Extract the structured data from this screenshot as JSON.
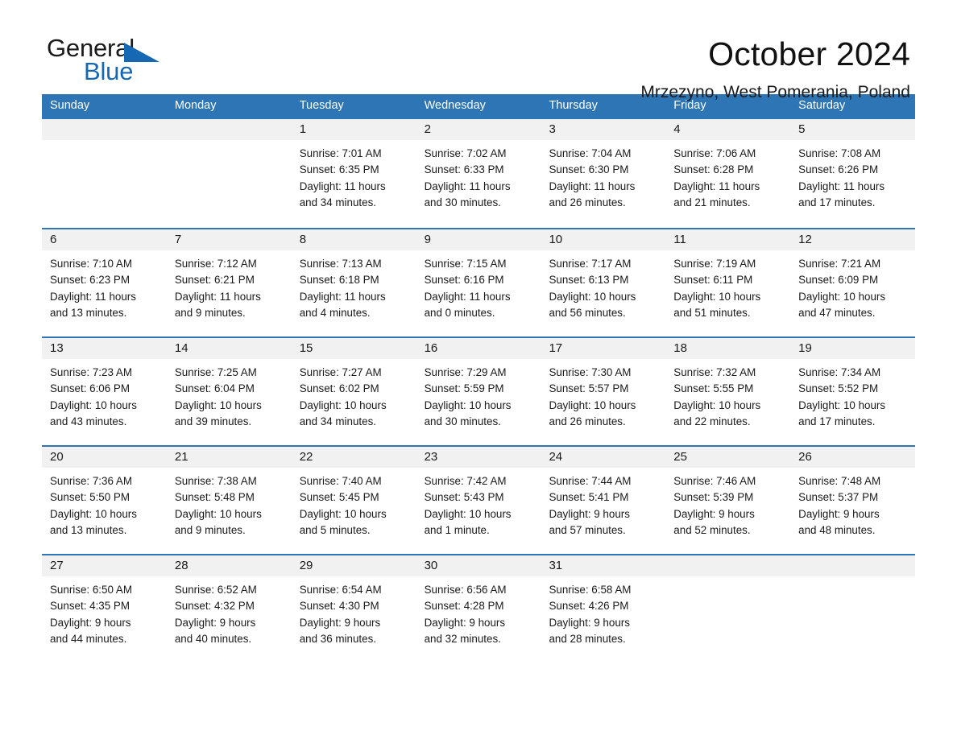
{
  "logo": {
    "word1": "General",
    "word2": "Blue",
    "triangle": "triangle-mark",
    "blue": "#1668b3"
  },
  "header": {
    "month_title": "October 2024",
    "location": "Mrzezyno, West Pomerania, Poland"
  },
  "colors": {
    "header_blue": "#2e75b6",
    "cell_number_band": "#f1f1f1",
    "text": "#1a1a1a"
  },
  "calendar": {
    "weekday_headers": [
      "Sunday",
      "Monday",
      "Tuesday",
      "Wednesday",
      "Thursday",
      "Friday",
      "Saturday"
    ],
    "weeks": [
      [
        {
          "day": "",
          "sunrise": "",
          "sunset": "",
          "daylight_line1": "",
          "daylight_line2": ""
        },
        {
          "day": "",
          "sunrise": "",
          "sunset": "",
          "daylight_line1": "",
          "daylight_line2": ""
        },
        {
          "day": "1",
          "sunrise": "Sunrise: 7:01 AM",
          "sunset": "Sunset: 6:35 PM",
          "daylight_line1": "Daylight: 11 hours",
          "daylight_line2": "and 34 minutes."
        },
        {
          "day": "2",
          "sunrise": "Sunrise: 7:02 AM",
          "sunset": "Sunset: 6:33 PM",
          "daylight_line1": "Daylight: 11 hours",
          "daylight_line2": "and 30 minutes."
        },
        {
          "day": "3",
          "sunrise": "Sunrise: 7:04 AM",
          "sunset": "Sunset: 6:30 PM",
          "daylight_line1": "Daylight: 11 hours",
          "daylight_line2": "and 26 minutes."
        },
        {
          "day": "4",
          "sunrise": "Sunrise: 7:06 AM",
          "sunset": "Sunset: 6:28 PM",
          "daylight_line1": "Daylight: 11 hours",
          "daylight_line2": "and 21 minutes."
        },
        {
          "day": "5",
          "sunrise": "Sunrise: 7:08 AM",
          "sunset": "Sunset: 6:26 PM",
          "daylight_line1": "Daylight: 11 hours",
          "daylight_line2": "and 17 minutes."
        }
      ],
      [
        {
          "day": "6",
          "sunrise": "Sunrise: 7:10 AM",
          "sunset": "Sunset: 6:23 PM",
          "daylight_line1": "Daylight: 11 hours",
          "daylight_line2": "and 13 minutes."
        },
        {
          "day": "7",
          "sunrise": "Sunrise: 7:12 AM",
          "sunset": "Sunset: 6:21 PM",
          "daylight_line1": "Daylight: 11 hours",
          "daylight_line2": "and 9 minutes."
        },
        {
          "day": "8",
          "sunrise": "Sunrise: 7:13 AM",
          "sunset": "Sunset: 6:18 PM",
          "daylight_line1": "Daylight: 11 hours",
          "daylight_line2": "and 4 minutes."
        },
        {
          "day": "9",
          "sunrise": "Sunrise: 7:15 AM",
          "sunset": "Sunset: 6:16 PM",
          "daylight_line1": "Daylight: 11 hours",
          "daylight_line2": "and 0 minutes."
        },
        {
          "day": "10",
          "sunrise": "Sunrise: 7:17 AM",
          "sunset": "Sunset: 6:13 PM",
          "daylight_line1": "Daylight: 10 hours",
          "daylight_line2": "and 56 minutes."
        },
        {
          "day": "11",
          "sunrise": "Sunrise: 7:19 AM",
          "sunset": "Sunset: 6:11 PM",
          "daylight_line1": "Daylight: 10 hours",
          "daylight_line2": "and 51 minutes."
        },
        {
          "day": "12",
          "sunrise": "Sunrise: 7:21 AM",
          "sunset": "Sunset: 6:09 PM",
          "daylight_line1": "Daylight: 10 hours",
          "daylight_line2": "and 47 minutes."
        }
      ],
      [
        {
          "day": "13",
          "sunrise": "Sunrise: 7:23 AM",
          "sunset": "Sunset: 6:06 PM",
          "daylight_line1": "Daylight: 10 hours",
          "daylight_line2": "and 43 minutes."
        },
        {
          "day": "14",
          "sunrise": "Sunrise: 7:25 AM",
          "sunset": "Sunset: 6:04 PM",
          "daylight_line1": "Daylight: 10 hours",
          "daylight_line2": "and 39 minutes."
        },
        {
          "day": "15",
          "sunrise": "Sunrise: 7:27 AM",
          "sunset": "Sunset: 6:02 PM",
          "daylight_line1": "Daylight: 10 hours",
          "daylight_line2": "and 34 minutes."
        },
        {
          "day": "16",
          "sunrise": "Sunrise: 7:29 AM",
          "sunset": "Sunset: 5:59 PM",
          "daylight_line1": "Daylight: 10 hours",
          "daylight_line2": "and 30 minutes."
        },
        {
          "day": "17",
          "sunrise": "Sunrise: 7:30 AM",
          "sunset": "Sunset: 5:57 PM",
          "daylight_line1": "Daylight: 10 hours",
          "daylight_line2": "and 26 minutes."
        },
        {
          "day": "18",
          "sunrise": "Sunrise: 7:32 AM",
          "sunset": "Sunset: 5:55 PM",
          "daylight_line1": "Daylight: 10 hours",
          "daylight_line2": "and 22 minutes."
        },
        {
          "day": "19",
          "sunrise": "Sunrise: 7:34 AM",
          "sunset": "Sunset: 5:52 PM",
          "daylight_line1": "Daylight: 10 hours",
          "daylight_line2": "and 17 minutes."
        }
      ],
      [
        {
          "day": "20",
          "sunrise": "Sunrise: 7:36 AM",
          "sunset": "Sunset: 5:50 PM",
          "daylight_line1": "Daylight: 10 hours",
          "daylight_line2": "and 13 minutes."
        },
        {
          "day": "21",
          "sunrise": "Sunrise: 7:38 AM",
          "sunset": "Sunset: 5:48 PM",
          "daylight_line1": "Daylight: 10 hours",
          "daylight_line2": "and 9 minutes."
        },
        {
          "day": "22",
          "sunrise": "Sunrise: 7:40 AM",
          "sunset": "Sunset: 5:45 PM",
          "daylight_line1": "Daylight: 10 hours",
          "daylight_line2": "and 5 minutes."
        },
        {
          "day": "23",
          "sunrise": "Sunrise: 7:42 AM",
          "sunset": "Sunset: 5:43 PM",
          "daylight_line1": "Daylight: 10 hours",
          "daylight_line2": "and 1 minute."
        },
        {
          "day": "24",
          "sunrise": "Sunrise: 7:44 AM",
          "sunset": "Sunset: 5:41 PM",
          "daylight_line1": "Daylight: 9 hours",
          "daylight_line2": "and 57 minutes."
        },
        {
          "day": "25",
          "sunrise": "Sunrise: 7:46 AM",
          "sunset": "Sunset: 5:39 PM",
          "daylight_line1": "Daylight: 9 hours",
          "daylight_line2": "and 52 minutes."
        },
        {
          "day": "26",
          "sunrise": "Sunrise: 7:48 AM",
          "sunset": "Sunset: 5:37 PM",
          "daylight_line1": "Daylight: 9 hours",
          "daylight_line2": "and 48 minutes."
        }
      ],
      [
        {
          "day": "27",
          "sunrise": "Sunrise: 6:50 AM",
          "sunset": "Sunset: 4:35 PM",
          "daylight_line1": "Daylight: 9 hours",
          "daylight_line2": "and 44 minutes."
        },
        {
          "day": "28",
          "sunrise": "Sunrise: 6:52 AM",
          "sunset": "Sunset: 4:32 PM",
          "daylight_line1": "Daylight: 9 hours",
          "daylight_line2": "and 40 minutes."
        },
        {
          "day": "29",
          "sunrise": "Sunrise: 6:54 AM",
          "sunset": "Sunset: 4:30 PM",
          "daylight_line1": "Daylight: 9 hours",
          "daylight_line2": "and 36 minutes."
        },
        {
          "day": "30",
          "sunrise": "Sunrise: 6:56 AM",
          "sunset": "Sunset: 4:28 PM",
          "daylight_line1": "Daylight: 9 hours",
          "daylight_line2": "and 32 minutes."
        },
        {
          "day": "31",
          "sunrise": "Sunrise: 6:58 AM",
          "sunset": "Sunset: 4:26 PM",
          "daylight_line1": "Daylight: 9 hours",
          "daylight_line2": "and 28 minutes."
        },
        {
          "day": "",
          "sunrise": "",
          "sunset": "",
          "daylight_line1": "",
          "daylight_line2": ""
        },
        {
          "day": "",
          "sunrise": "",
          "sunset": "",
          "daylight_line1": "",
          "daylight_line2": ""
        }
      ]
    ]
  }
}
